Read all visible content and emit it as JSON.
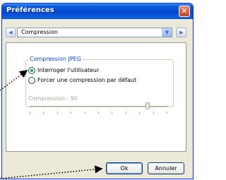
{
  "window": {
    "title": "Préférences",
    "close_symbol": "✕"
  },
  "category": {
    "prev_symbol": "◀",
    "next_symbol": "▶",
    "dropdown_symbol": "▼",
    "selected": "Compression"
  },
  "jpeg_group": {
    "title": "Compression JPEG",
    "options": [
      {
        "label": "Interroger l'utilisateur",
        "checked": true
      },
      {
        "label": "Forcer une compression par défaut",
        "checked": false
      }
    ],
    "slider_label": "Compression : 90",
    "slider_value": 90
  },
  "buttons": {
    "ok": "Ok",
    "cancel": "Annuler"
  },
  "colors": {
    "titlebar": "#0348d0",
    "group_title": "#0046d5",
    "annotation_arrow": "#000000"
  }
}
